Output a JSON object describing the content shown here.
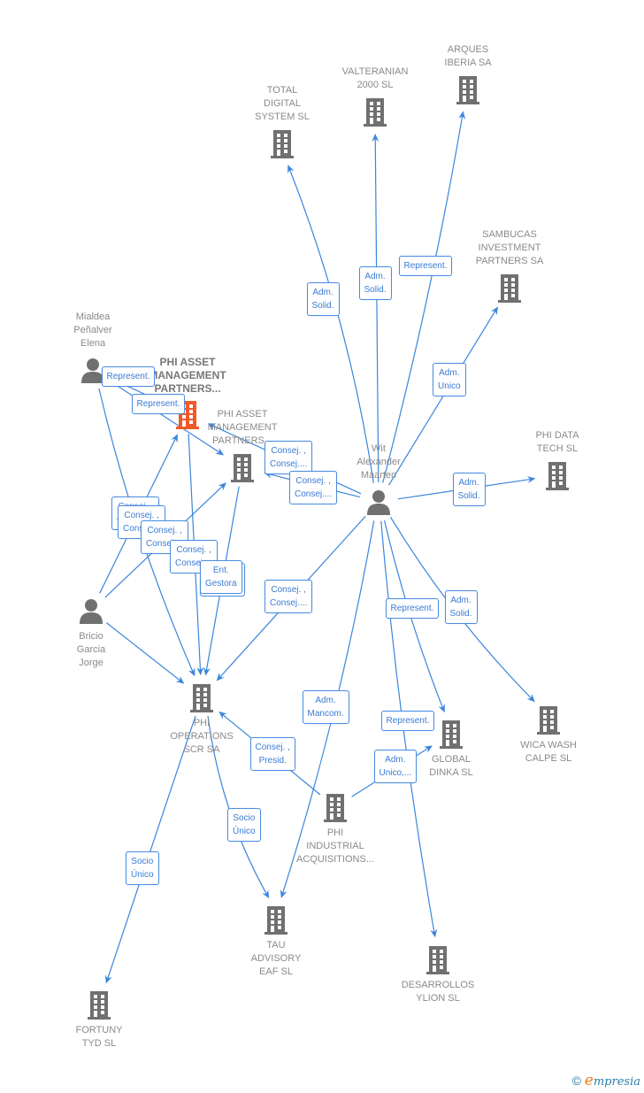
{
  "colors": {
    "edge": "#3a85dc",
    "node_gray": "#707070",
    "node_highlight": "#f05a28",
    "label_text": "#8a8a8a"
  },
  "nodes": [
    {
      "id": "total_digital",
      "type": "company",
      "label": "TOTAL\nDIGITAL\nSYSTEM SL"
    },
    {
      "id": "valteranian",
      "type": "company",
      "label": "VALTERANIAN\n2000 SL"
    },
    {
      "id": "arques",
      "type": "company",
      "label": "ARQUES\nIBERIA SA"
    },
    {
      "id": "sambucas",
      "type": "company",
      "label": "SAMBUCAS\nINVESTMENT\nPARTNERS SA"
    },
    {
      "id": "phi_data",
      "type": "company",
      "label": "PHI DATA\nTECH  SL"
    },
    {
      "id": "mialdea",
      "type": "person",
      "label": "Mialdea\nPeñalver\nElena"
    },
    {
      "id": "phi_asset_main",
      "type": "company-highlight",
      "label": "PHI ASSET\nMANAGEMENT\nPARTNERS..."
    },
    {
      "id": "phi_asset_2",
      "type": "company",
      "label": "PHI ASSET\nMANAGEMENT\nPARTNERS..."
    },
    {
      "id": "wit",
      "type": "person",
      "label": "Wit\nAlexander\nMaarten"
    },
    {
      "id": "bricio",
      "type": "person",
      "label": "Bricio\nGarcia\nJorge"
    },
    {
      "id": "phi_operations",
      "type": "company",
      "label": "PHI\nOPERATIONS\nSCR SA"
    },
    {
      "id": "wica",
      "type": "company",
      "label": "WICA WASH\nCALPE SL"
    },
    {
      "id": "global_dinka",
      "type": "company",
      "label": "GLOBAL\nDINKA  SL"
    },
    {
      "id": "phi_industrial",
      "type": "company",
      "label": "PHI\nINDUSTRIAL\nACQUISITIONS..."
    },
    {
      "id": "tau",
      "type": "company",
      "label": "TAU\nADVISORY\nEAF  SL"
    },
    {
      "id": "desarrollos",
      "type": "company",
      "label": "DESARROLLOS\nYLION  SL"
    },
    {
      "id": "fortuny",
      "type": "company",
      "label": "FORTUNY\nTYD  SL"
    }
  ],
  "edges": [
    {
      "from": "wit",
      "to": "total_digital",
      "label": "Adm.\nSolid."
    },
    {
      "from": "wit",
      "to": "valteranian",
      "label": "Adm.\nSolid."
    },
    {
      "from": "wit",
      "to": "arques",
      "label": "Represent."
    },
    {
      "from": "wit",
      "to": "sambucas",
      "label": "Adm.\nUnico"
    },
    {
      "from": "wit",
      "to": "phi_data",
      "label": "Adm.\nSolid."
    },
    {
      "from": "wit",
      "to": "phi_asset_main",
      "label": "Consej. ,\nConsej...."
    },
    {
      "from": "wit",
      "to": "phi_asset_2",
      "label": "Consej. ,\nConsej...."
    },
    {
      "from": "wit",
      "to": "phi_operations",
      "label": "Consej. ,\nConsej...."
    },
    {
      "from": "wit",
      "to": "tau",
      "label": "Adm.\nMancom."
    },
    {
      "from": "wit",
      "to": "global_dinka",
      "label": "Represent."
    },
    {
      "from": "wit",
      "to": "wica",
      "label": "Adm.\nSolid."
    },
    {
      "from": "wit",
      "to": "desarrollos",
      "label": "Represent."
    },
    {
      "from": "mialdea",
      "to": "phi_asset_main",
      "label": "Represent."
    },
    {
      "from": "mialdea",
      "to": "phi_asset_2",
      "label": "Represent."
    },
    {
      "from": "mialdea",
      "to": "phi_operations",
      "label": "Consej. ,\nConsej...."
    },
    {
      "from": "bricio",
      "to": "phi_asset_main",
      "label": "Consej. ,\nConsej...."
    },
    {
      "from": "bricio",
      "to": "phi_asset_2",
      "label": "Consej. ,\nConsej...."
    },
    {
      "from": "bricio",
      "to": "phi_operations",
      "label": "Consej. ,\nConsej...."
    },
    {
      "from": "phi_asset_main",
      "to": "phi_operations",
      "label": "Consej. ,\nPresid."
    },
    {
      "from": "phi_asset_2",
      "to": "phi_operations",
      "label": "Ent.\nGestora"
    },
    {
      "from": "phi_industrial",
      "to": "phi_operations",
      "label": "Consej. ,\nPresid."
    },
    {
      "from": "phi_industrial",
      "to": "global_dinka",
      "label": "Adm.\nUnico,..."
    },
    {
      "from": "phi_operations",
      "to": "tau",
      "label": "Socio\nÚnico"
    },
    {
      "from": "phi_operations",
      "to": "fortuny",
      "label": "Socio\nÚnico"
    }
  ],
  "footer": {
    "copyright": "©",
    "brand_initial": "e",
    "brand_rest": "mpresia"
  }
}
